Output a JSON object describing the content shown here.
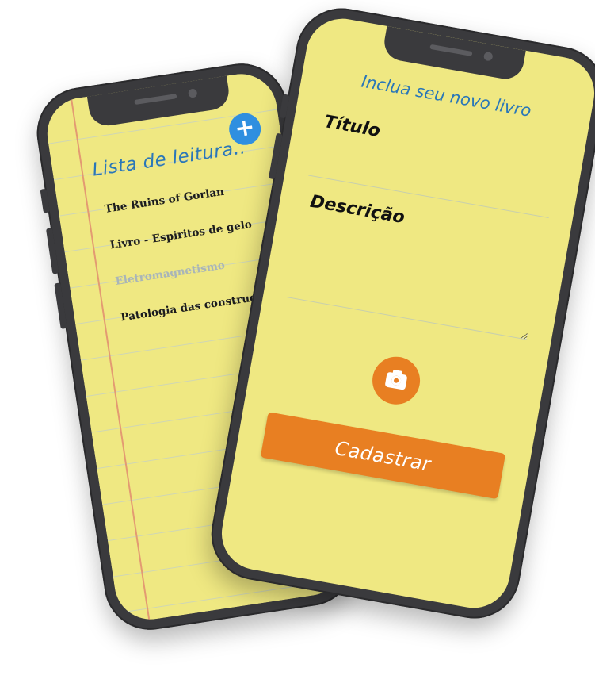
{
  "reading_list": {
    "title": "Lista de leitura..",
    "add_button_label": "+",
    "books": [
      {
        "title": "The Ruins of Gorlan",
        "faded": false
      },
      {
        "title": "Livro - Espiritos de gelo",
        "faded": false
      },
      {
        "title": "Eletromagnetismo",
        "faded": true
      },
      {
        "title": "Patologia das construções",
        "faded": false
      }
    ]
  },
  "new_book_form": {
    "header": "Inclua seu novo livro",
    "title_label": "Título",
    "description_label": "Descrição",
    "title_value": "",
    "description_value": "",
    "submit_label": "Cadastrar"
  },
  "colors": {
    "paper": "#efe882",
    "ink_blue": "#2a77b8",
    "accent_orange": "#e87f22",
    "add_button_blue": "#2f8fe0",
    "margin_red": "#e39a72",
    "phone_frame": "#3a3a3d"
  },
  "icons": {
    "add": "plus-icon",
    "camera": "camera-icon"
  }
}
